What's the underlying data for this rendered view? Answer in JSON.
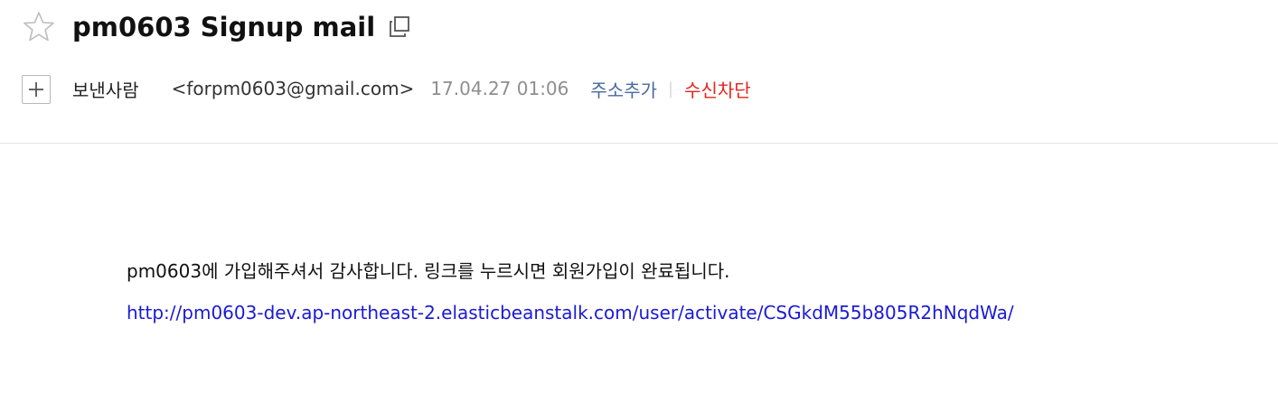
{
  "header": {
    "subject": "pm0603 Signup mail"
  },
  "sender": {
    "label": "보낸사람",
    "email": "<forpm0603@gmail.com>",
    "date": "17.04.27 01:06",
    "add_contact_label": "주소추가",
    "separator": "|",
    "block_label": "수신차단"
  },
  "body": {
    "message": "pm0603에 가입해주셔서 감사합니다. 링크를 누르시면 회원가입이 완료됩니다.",
    "link": "http://pm0603-dev.ap-northeast-2.elasticbeanstalk.com/user/activate/CSGkdM55b805R2hNqdWa/"
  },
  "icons": {
    "star": "star-outline-icon",
    "copy": "copy-window-icon",
    "add": "plus-icon"
  },
  "colors": {
    "add_contact": "#4a6aa0",
    "block": "#e0261c",
    "link": "#1a1ad6",
    "date": "#8e8e8e"
  }
}
